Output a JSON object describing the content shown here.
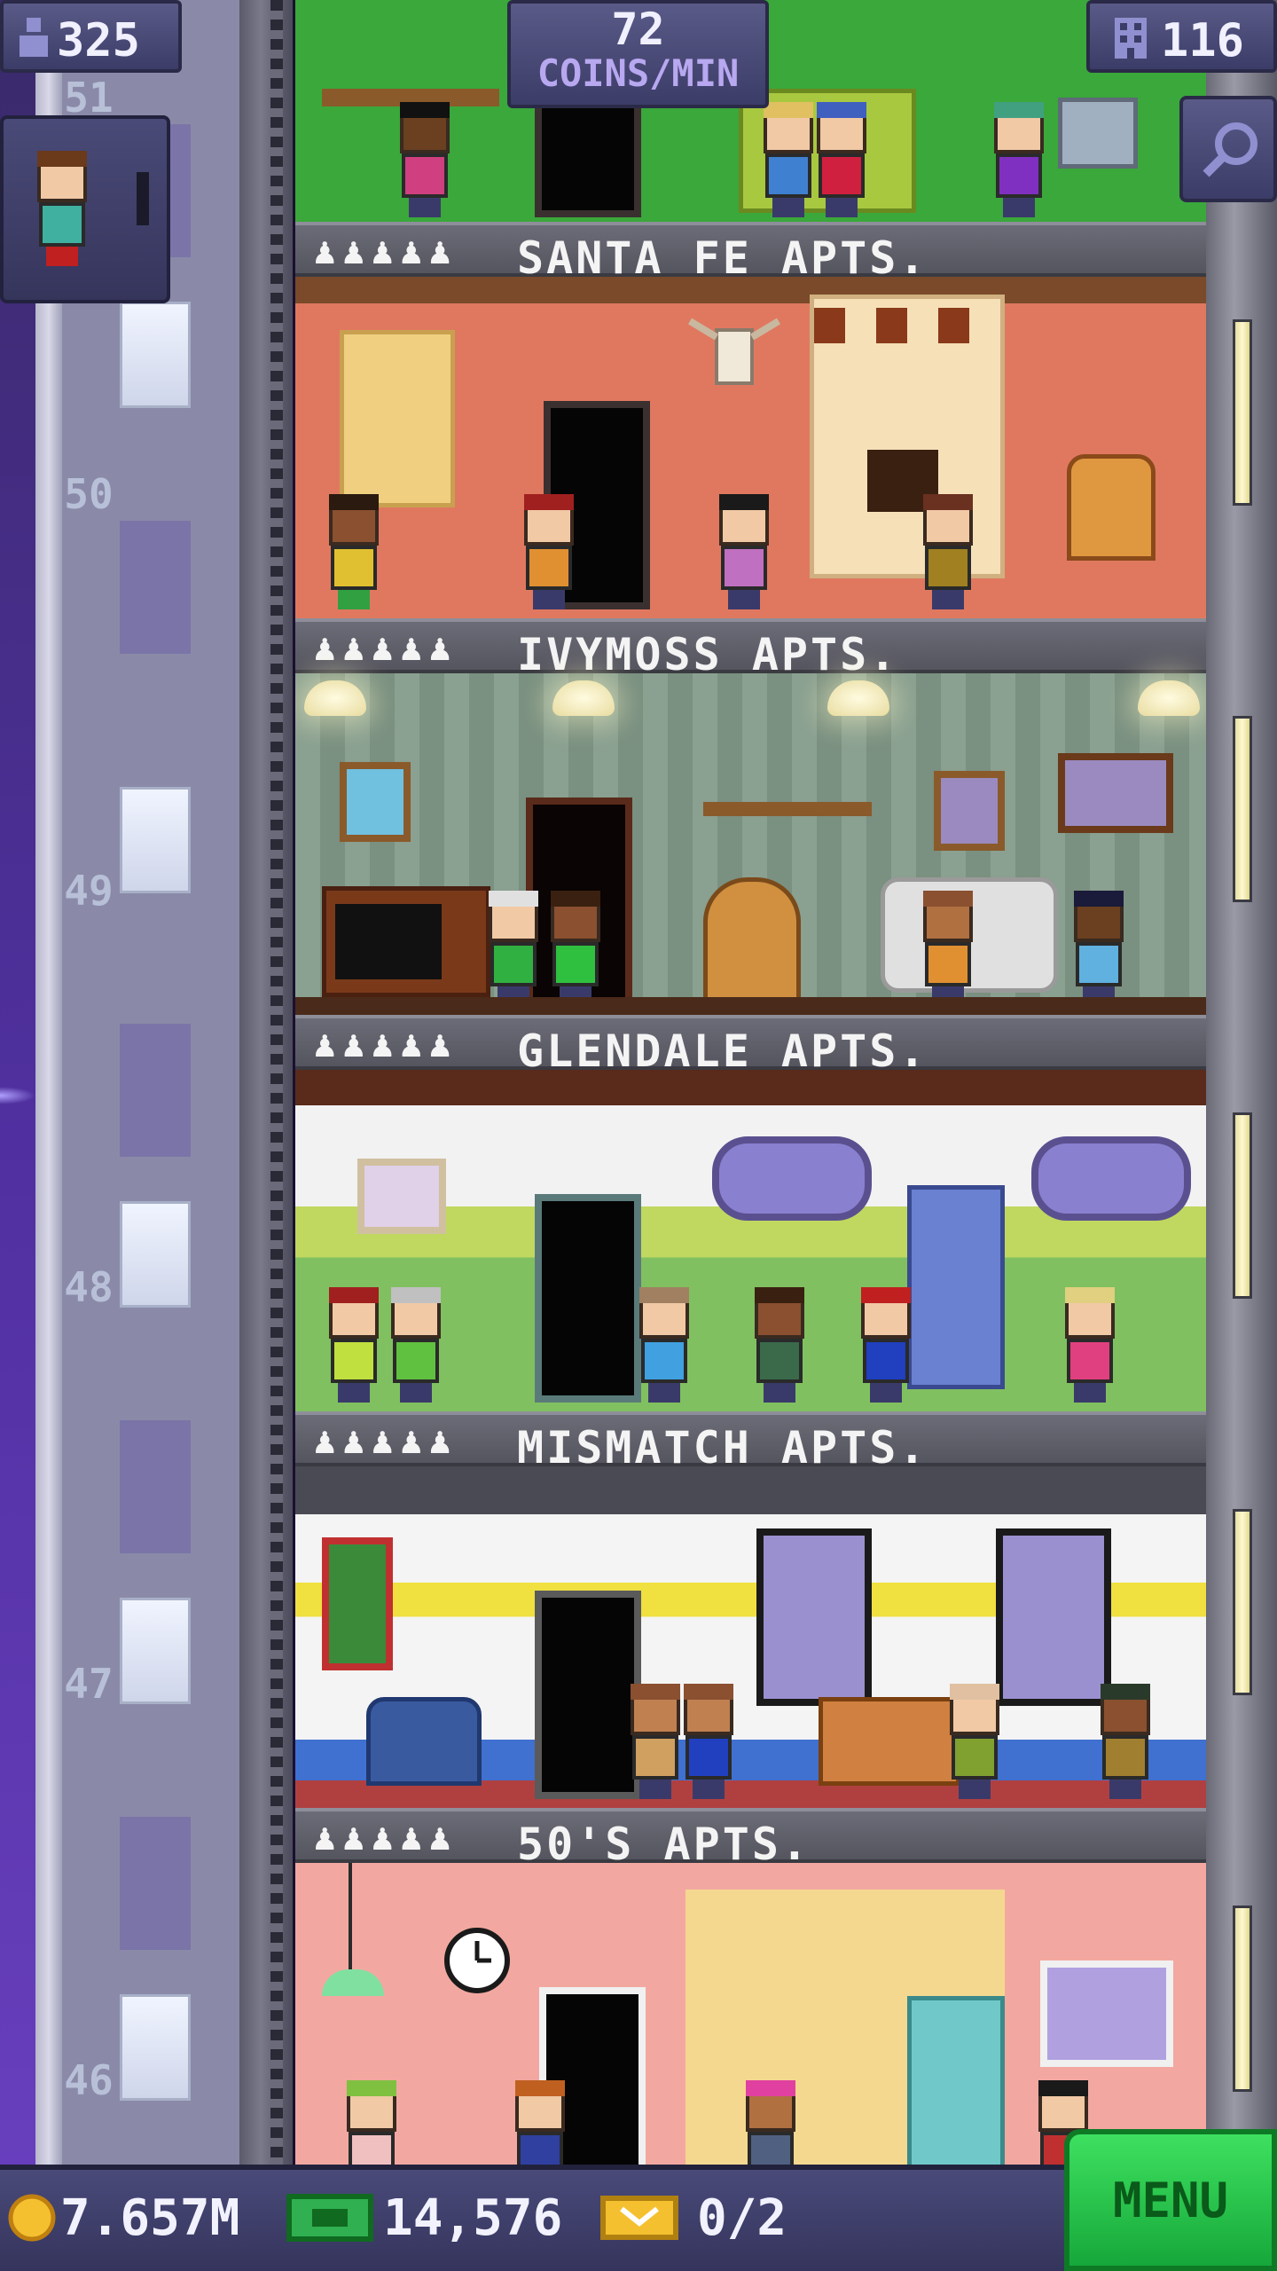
{
  "hud": {
    "population": "325",
    "coins_per_min_value": "72",
    "coins_per_min_unit": "COINS/MIN",
    "floor_count": "116"
  },
  "shaft": {
    "floor_numbers": [
      "51",
      "50",
      "49",
      "48",
      "47",
      "46"
    ]
  },
  "floors": [
    {
      "name": "SANTA FE APTS.",
      "residents_icon": "♟♟♟♟♟"
    },
    {
      "name": "IVYMOSS APTS.",
      "residents_icon": "♟♟♟♟♟"
    },
    {
      "name": "GLENDALE APTS.",
      "residents_icon": "♟♟♟♟♟"
    },
    {
      "name": "MISMATCH APTS.",
      "residents_icon": "♟♟♟♟♟"
    },
    {
      "name": "50'S APTS.",
      "residents_icon": "♟♟♟♟♟"
    }
  ],
  "bottom_bar": {
    "coins": "7.657M",
    "bux": "14,576",
    "tickets": "0/2",
    "menu_label": "MENU"
  },
  "colors": {
    "hud_bg": "#4a4a7a",
    "menu_green": "#2ec44c",
    "coin_gold": "#f5c030"
  }
}
